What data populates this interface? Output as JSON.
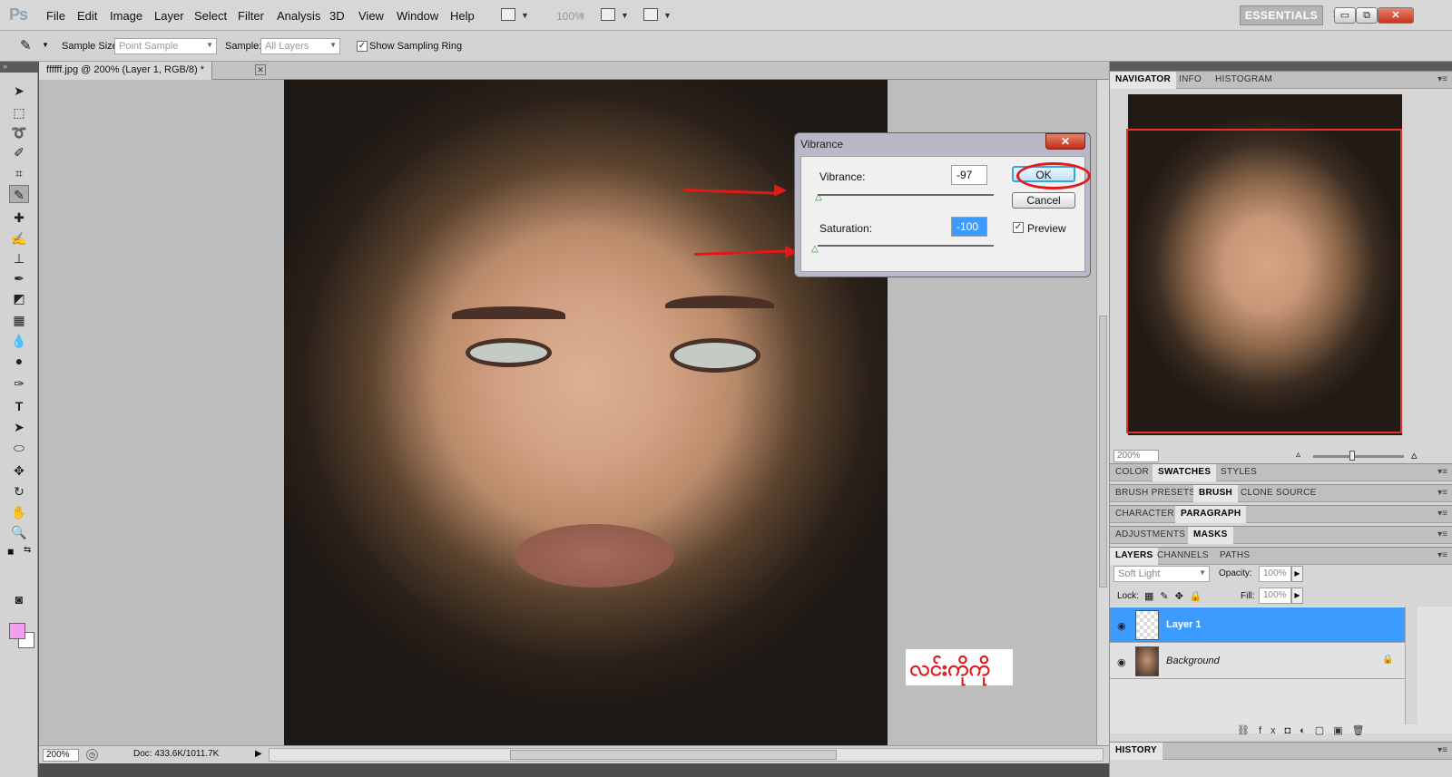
{
  "app": {
    "logo": "Ps"
  },
  "menu": [
    "File",
    "Edit",
    "Image",
    "Layer",
    "Select",
    "Filter",
    "Analysis",
    "3D",
    "View",
    "Window",
    "Help"
  ],
  "toolbar": {
    "zoom": "100%",
    "workspace": "ESSENTIALS",
    "more": "»"
  },
  "window_controls": {
    "minimize": "▭",
    "restore": "⧉",
    "close": "✕"
  },
  "options": {
    "sample_size_label": "Sample Size:",
    "sample_size_value": "Point Sample",
    "sample_label": "Sample:",
    "sample_value": "All Layers",
    "show_ring_label": "Show Sampling Ring",
    "show_ring_checked": "✓"
  },
  "document": {
    "tab_title": "ffffff.jpg @ 200% (Layer 1, RGB/8) *",
    "tab_close": "✕",
    "zoom": "200%",
    "doc_info": "Doc: 433.6K/1011.7K"
  },
  "dialog": {
    "title": "Vibrance",
    "close": "✕",
    "vibrance_label": "Vibrance:",
    "vibrance_value": "-97",
    "saturation_label": "Saturation:",
    "saturation_value": "-100",
    "ok": "OK",
    "cancel": "Cancel",
    "preview_label": "Preview",
    "preview_checked": "✓"
  },
  "panels": {
    "navigator_tabs": [
      "NAVIGATOR",
      "INFO",
      "HISTOGRAM"
    ],
    "navigator_zoom": "200%",
    "color_tabs": [
      "COLOR",
      "SWATCHES",
      "STYLES"
    ],
    "brush_tabs": [
      "BRUSH PRESETS",
      "BRUSH",
      "CLONE SOURCE"
    ],
    "char_tabs": [
      "CHARACTER",
      "PARAGRAPH"
    ],
    "adj_tabs": [
      "ADJUSTMENTS",
      "MASKS"
    ],
    "layers_tabs": [
      "LAYERS",
      "CHANNELS",
      "PATHS"
    ],
    "blend_mode": "Soft Light",
    "opacity_label": "Opacity:",
    "opacity_value": "100%",
    "lock_label": "Lock:",
    "fill_label": "Fill:",
    "fill_value": "100%",
    "layers": [
      "Layer 1",
      "Background"
    ],
    "history_tab": "HISTORY"
  },
  "overlay_text": "လင်းကိုကို",
  "colors": {
    "accent": "#3d9bff",
    "foreground": "#f49ef2",
    "annotation": "#e21818"
  }
}
